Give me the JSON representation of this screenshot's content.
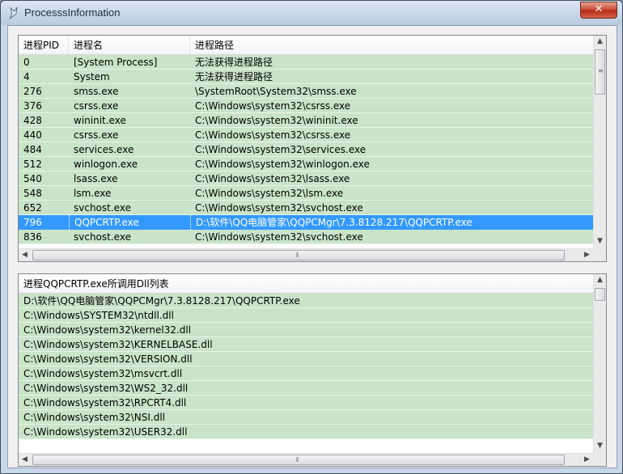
{
  "window": {
    "title": "ProcesssInformation",
    "close_label": "✕"
  },
  "process_list": {
    "headers": [
      "进程PID",
      "进程名",
      "进程路径"
    ],
    "rows": [
      {
        "pid": "0",
        "name": "[System Process]",
        "path": "无法获得进程路径"
      },
      {
        "pid": "4",
        "name": "System",
        "path": "无法获得进程路径"
      },
      {
        "pid": "276",
        "name": "smss.exe",
        "path": "\\SystemRoot\\System32\\smss.exe"
      },
      {
        "pid": "376",
        "name": "csrss.exe",
        "path": "C:\\Windows\\system32\\csrss.exe"
      },
      {
        "pid": "428",
        "name": "wininit.exe",
        "path": "C:\\Windows\\system32\\wininit.exe"
      },
      {
        "pid": "440",
        "name": "csrss.exe",
        "path": "C:\\Windows\\system32\\csrss.exe"
      },
      {
        "pid": "484",
        "name": "services.exe",
        "path": "C:\\Windows\\system32\\services.exe"
      },
      {
        "pid": "512",
        "name": "winlogon.exe",
        "path": "C:\\Windows\\system32\\winlogon.exe"
      },
      {
        "pid": "540",
        "name": "lsass.exe",
        "path": "C:\\Windows\\system32\\lsass.exe"
      },
      {
        "pid": "548",
        "name": "lsm.exe",
        "path": "C:\\Windows\\system32\\lsm.exe"
      },
      {
        "pid": "652",
        "name": "svchost.exe",
        "path": "C:\\Windows\\system32\\svchost.exe"
      },
      {
        "pid": "796",
        "name": "QQPCRTP.exe",
        "path": "D:\\软件\\QQ电脑管家\\QQPCMgr\\7.3.8128.217\\QQPCRTP.exe",
        "selected": true
      },
      {
        "pid": "836",
        "name": "svchost.exe",
        "path": "C:\\Windows\\system32\\svchost.exe"
      }
    ]
  },
  "dll_list": {
    "header": "进程QQPCRTP.exe所调用Dll列表",
    "rows": [
      "D:\\软件\\QQ电脑管家\\QQPCMgr\\7.3.8128.217\\QQPCRTP.exe",
      "C:\\Windows\\SYSTEM32\\ntdll.dll",
      "C:\\Windows\\system32\\kernel32.dll",
      "C:\\Windows\\system32\\KERNELBASE.dll",
      "C:\\Windows\\system32\\VERSION.dll",
      "C:\\Windows\\system32\\msvcrt.dll",
      "C:\\Windows\\system32\\WS2_32.dll",
      "C:\\Windows\\system32\\RPCRT4.dll",
      "C:\\Windows\\system32\\NSI.dll",
      "C:\\Windows\\system32\\USER32.dll"
    ]
  },
  "icons": {
    "app": "app-feather-icon",
    "scroll_up": "▲",
    "scroll_down": "▼",
    "scroll_left": "◀",
    "scroll_right": "▶"
  },
  "colors": {
    "row_bg": "#c9e4c9",
    "selected_bg": "#3399ff"
  }
}
